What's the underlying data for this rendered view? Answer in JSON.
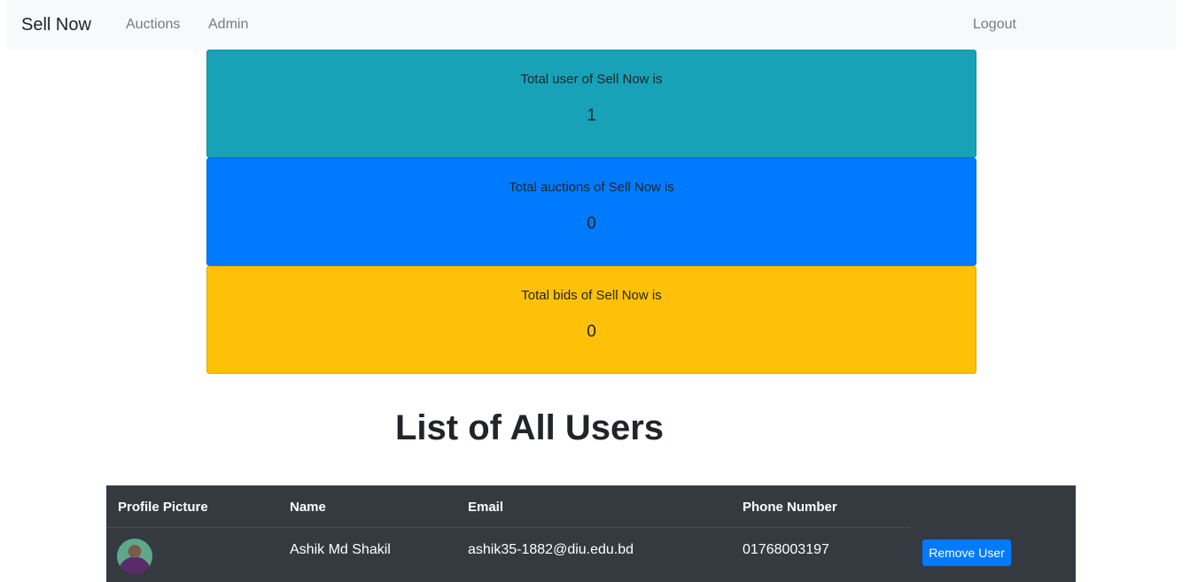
{
  "navbar": {
    "brand": "Sell Now",
    "links": [
      {
        "label": "Auctions"
      },
      {
        "label": "Admin"
      }
    ],
    "logout_label": "Logout"
  },
  "stats": [
    {
      "label": "Total user of Sell Now is",
      "value": "1",
      "color": "#17a2b8"
    },
    {
      "label": "Total auctions of Sell Now is",
      "value": "0",
      "color": "#007bff"
    },
    {
      "label": "Total bids of Sell Now is",
      "value": "0",
      "color": "#ffc107"
    }
  ],
  "users_section": {
    "title": "List of All Users",
    "columns": [
      "Profile Picture",
      "Name",
      "Email",
      "Phone Number"
    ],
    "rows": [
      {
        "name": "Ashik Md Shakil",
        "email": "ashik35-1882@diu.edu.bd",
        "phone": "01768003197",
        "action_label": "Remove User"
      }
    ]
  },
  "colors": {
    "navbar_bg": "#f8f9fa",
    "table_bg": "#343a40",
    "button_primary": "#007bff"
  }
}
